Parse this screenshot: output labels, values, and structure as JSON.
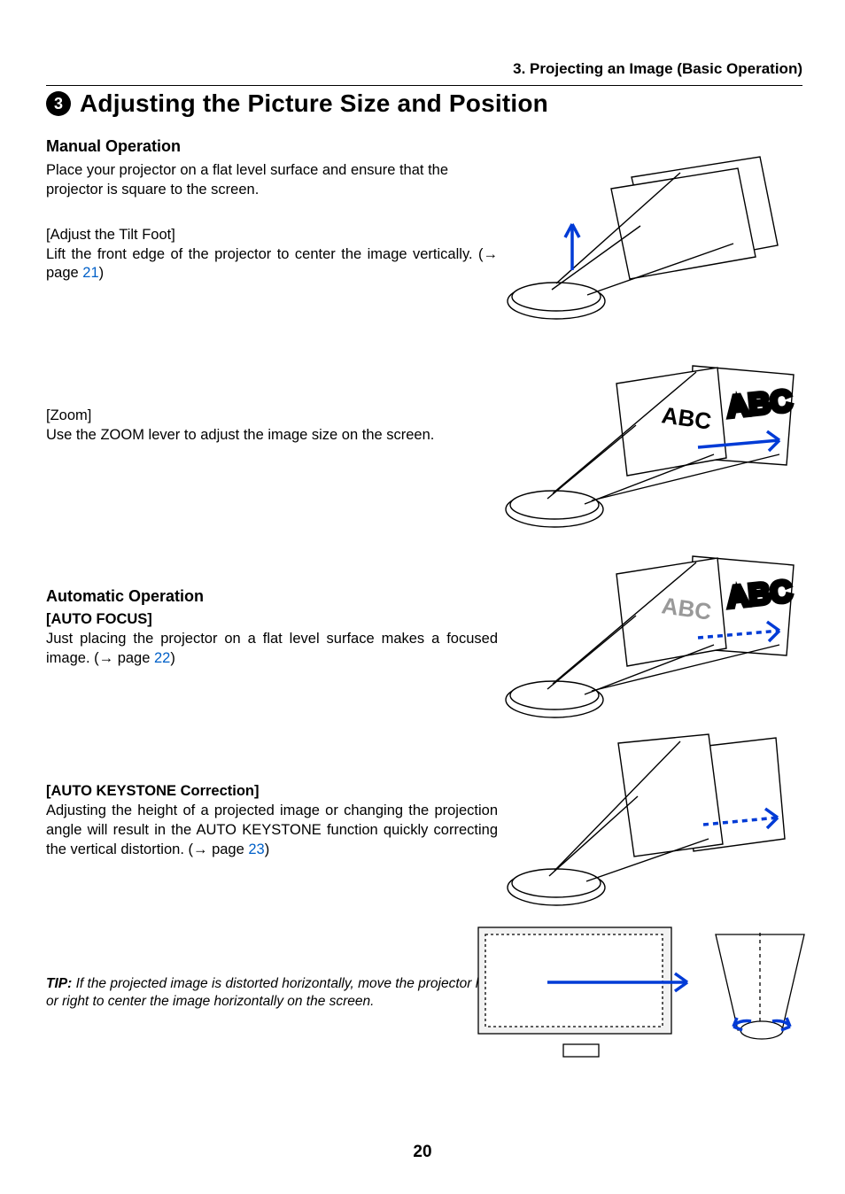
{
  "header": {
    "chapter": "3. Projecting an Image (Basic Operation)"
  },
  "title": {
    "bullet_num": "3",
    "text": "Adjusting the Picture Size and Position"
  },
  "manual": {
    "heading": "Manual Operation",
    "intro": "Place your projector on a flat level surface and ensure that the projector is square to the screen.",
    "tilt_label": "[Adjust the Tilt Foot]",
    "tilt_body_a": "Lift the front edge of the projector to center the image vertically. (",
    "tilt_arrow": "→",
    "tilt_page_word": " page ",
    "tilt_page": "21",
    "tilt_body_b": ")",
    "zoom_label": "[Zoom]",
    "zoom_body": "Use the ZOOM lever to adjust the image size on the screen."
  },
  "auto": {
    "heading": "Automatic Operation",
    "focus_label": "[AUTO FOCUS]",
    "focus_body_a": "Just placing the projector on a flat level surface makes a focused image. (",
    "focus_arrow": "→",
    "focus_page_word": " page ",
    "focus_page": "22",
    "focus_body_b": ")",
    "keystone_label": "[AUTO KEYSTONE Correction]",
    "keystone_body_a": "Adjusting the height of a projected image or changing the projection angle will result in the AUTO KEYSTONE function quickly correcting the vertical distortion. (",
    "keystone_arrow": "→",
    "keystone_page_word": " page ",
    "keystone_page": "23",
    "keystone_body_b": ")"
  },
  "tip": {
    "lead": "TIP:",
    "body": " If the projected image is distorted horizontally, move the projector left or right to center the image horizontally on the screen."
  },
  "labels": {
    "abc": "ABC"
  },
  "page_number": "20"
}
